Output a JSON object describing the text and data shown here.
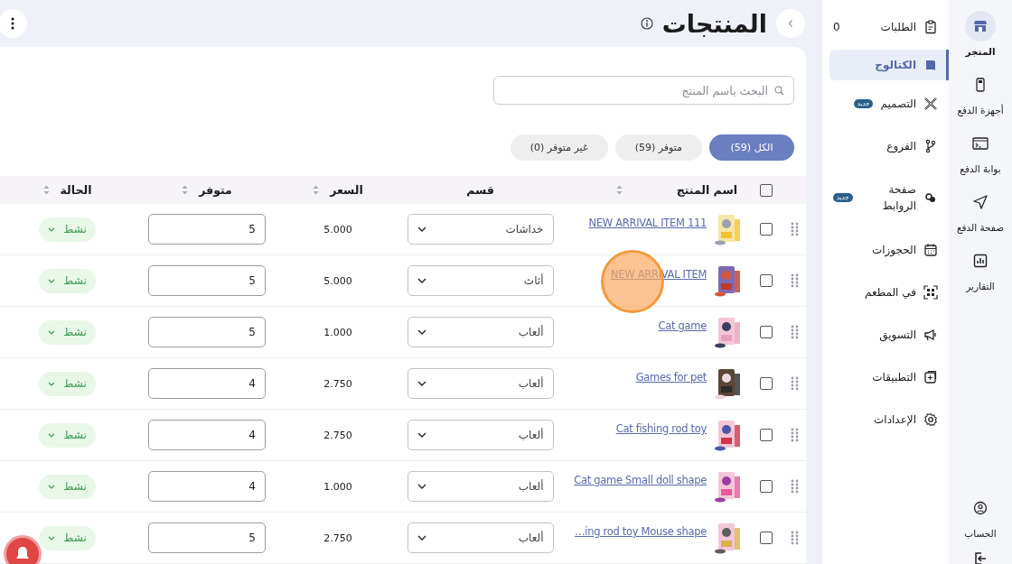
{
  "rail": {
    "items": [
      {
        "label": "المتجر",
        "selected": true
      },
      {
        "label": "أجهزة الدفع",
        "selected": false
      },
      {
        "label": "بوابة الدفع",
        "selected": false
      },
      {
        "label": "صفحة الدفع",
        "selected": false
      },
      {
        "label": "التقارير",
        "selected": false
      }
    ],
    "bottom": [
      {
        "label": "الحساب"
      }
    ]
  },
  "nav": {
    "items": [
      {
        "label": "الطلبات",
        "selected": false,
        "count": "0"
      },
      {
        "label": "الكتالوج",
        "selected": true
      },
      {
        "label": "التصميم",
        "selected": false,
        "badge": "جديد"
      },
      {
        "label": "الفروع",
        "selected": false
      },
      {
        "label": "صفحة الروابط",
        "selected": false,
        "badge": "جديد"
      },
      {
        "label": "الحجوزات",
        "selected": false
      },
      {
        "label": "في المطعم",
        "selected": false
      },
      {
        "label": "التسويق",
        "selected": false
      },
      {
        "label": "التطبيقات",
        "selected": false
      },
      {
        "label": "الإعدادات",
        "selected": false
      }
    ]
  },
  "header": {
    "title": "المنتجات"
  },
  "search": {
    "placeholder": "البحث باسم المنتج"
  },
  "filters": [
    {
      "label": "الكل (59)",
      "selected": true
    },
    {
      "label": "متوفر (59)",
      "selected": false
    },
    {
      "label": "غير متوفر (0)",
      "selected": false
    }
  ],
  "table": {
    "select_all": {
      "checked": false
    },
    "columns": [
      {
        "label": "اسم المنتج",
        "sortable": true
      },
      {
        "label": "قسم",
        "sortable": false
      },
      {
        "label": "السعر",
        "sortable": true
      },
      {
        "label": "متوفر",
        "sortable": true
      },
      {
        "label": "الحالة",
        "sortable": true
      }
    ],
    "rows": [
      {
        "checked": false,
        "name": "NEW ARRIVAL ITEM 111",
        "category": "خداشات",
        "price": "5.000",
        "stock": "5",
        "status": "نشط"
      },
      {
        "checked": false,
        "name": "NEW ARRIVAL ITEM",
        "category": "أثاث",
        "price": "5.000",
        "stock": "5",
        "status": "نشط"
      },
      {
        "checked": false,
        "name": "Cat game",
        "category": "ألعاب",
        "price": "1.000",
        "stock": "5",
        "status": "نشط"
      },
      {
        "checked": false,
        "name": "Games for pet",
        "category": "ألعاب",
        "price": "2.750",
        "stock": "4",
        "status": "نشط"
      },
      {
        "checked": false,
        "name": "Cat fishing rod toy",
        "category": "ألعاب",
        "price": "2.750",
        "stock": "4",
        "status": "نشط"
      },
      {
        "checked": false,
        "name": "Cat game Small doll shape",
        "category": "ألعاب",
        "price": "1.000",
        "stock": "4",
        "status": "نشط"
      },
      {
        "checked": false,
        "name": "…ing rod toy Mouse shape",
        "category": "ألعاب",
        "price": "2.750",
        "stock": "5",
        "status": "نشط"
      }
    ]
  }
}
